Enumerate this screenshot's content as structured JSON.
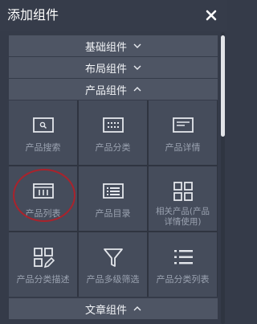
{
  "panel": {
    "title": "添加组件",
    "close_icon": "close-icon"
  },
  "sections": {
    "basic": {
      "label": "基础组件",
      "chevron": "chevron-down-icon"
    },
    "layout": {
      "label": "布局组件",
      "chevron": "chevron-down-icon"
    },
    "product": {
      "label": "产品组件",
      "chevron": "chevron-up-icon"
    },
    "article": {
      "label": "文章组件",
      "chevron": "chevron-up-icon"
    }
  },
  "product_items": [
    {
      "label": "产品搜索",
      "icon": "search-box-icon"
    },
    {
      "label": "产品分类",
      "icon": "grid-dots-icon"
    },
    {
      "label": "产品详情",
      "icon": "detail-window-icon"
    },
    {
      "label": "产品列表",
      "icon": "column-list-icon"
    },
    {
      "label": "产品目录",
      "icon": "catalog-icon"
    },
    {
      "label": "相关产品(产品详情使用)",
      "icon": "four-squares-icon"
    },
    {
      "label": "产品分类描述",
      "icon": "edit-grid-icon"
    },
    {
      "label": "产品多级筛选",
      "icon": "filter-icon"
    },
    {
      "label": "产品分类列表",
      "icon": "bullet-list-icon"
    }
  ],
  "colors": {
    "background": "#353b49",
    "section_bar": "#4e5564",
    "tile": "#454c5b",
    "highlight_ring": "#a9232c"
  }
}
